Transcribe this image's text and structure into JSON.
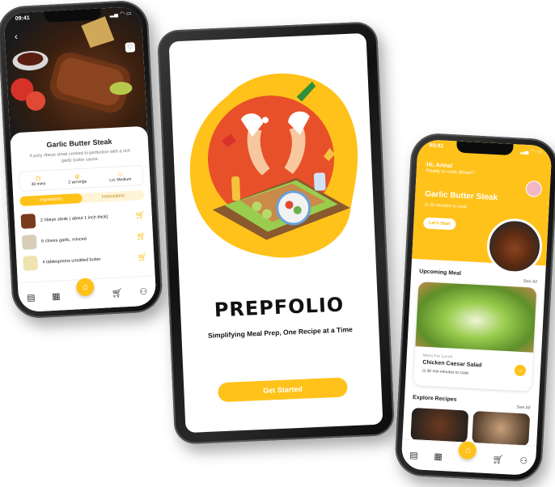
{
  "left_phone": {
    "time": "09:41",
    "recipe_title": "Garlic Butter Steak",
    "recipe_desc": "A juicy ribeye steak cooked to perfection with a rich garlic butter sauce.",
    "stats": [
      {
        "label": "30 mins"
      },
      {
        "label": "2 servings"
      },
      {
        "label": "Lvl. Medium"
      }
    ],
    "tabs": [
      "Ingredients",
      "Instructions"
    ],
    "ingredients": [
      "2 ribeye steak ( about 1 inch thick)",
      "6 cloves garlic, minced",
      "4 tablespoons unsalted butter"
    ]
  },
  "tablet": {
    "brand": "PREPFOLIO",
    "tagline": "Simplifying Meal Prep, One Recipe at a Time",
    "cta": "Get Started"
  },
  "right_phone": {
    "time": "09:41",
    "greeting": "Hi, Anna!",
    "subgreeting": "Ready to cook dinner?",
    "featured_title": "Garlic Butter Steak",
    "featured_time": "20 minutes to cook",
    "featured_cta": "Let's Start",
    "upcoming_heading": "Upcoming Meal",
    "see_all_1": "See All",
    "meal_category": "Menu For Lunch",
    "meal_title": "Chicken Caesar Salad",
    "meal_time": "30 min minutes to cook",
    "explore_heading": "Explore Recipes",
    "see_all_2": "See All"
  },
  "colors": {
    "accent": "#ffc21a",
    "blob_orange": "#e8502a",
    "blob_yellow": "#ffc21a"
  }
}
